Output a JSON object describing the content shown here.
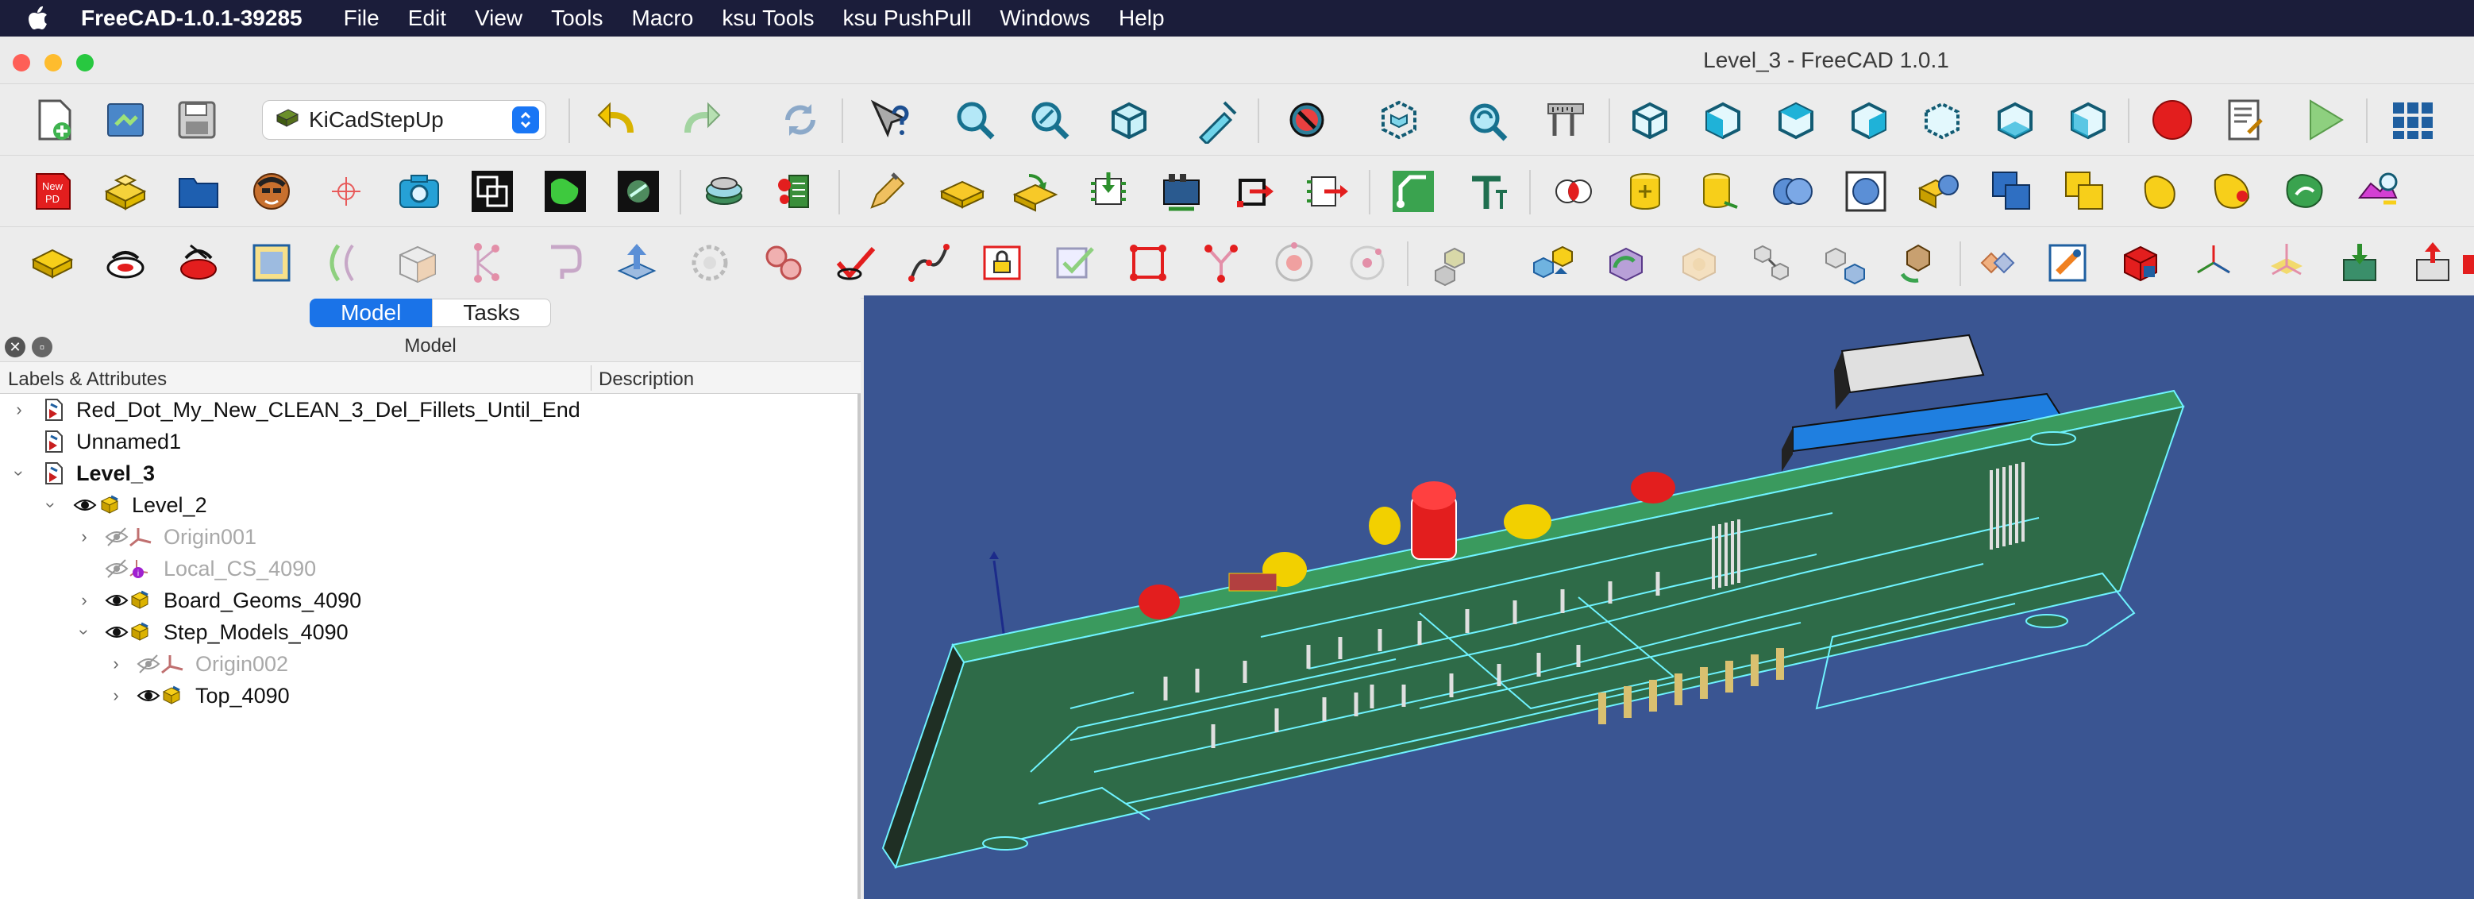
{
  "menubar": {
    "app_name": "FreeCAD-1.0.1-39285",
    "items": [
      "File",
      "Edit",
      "View",
      "Tools",
      "Macro",
      "ksu Tools",
      "ksu PushPull",
      "Windows",
      "Help"
    ]
  },
  "window": {
    "title": "Level_3 - FreeCAD 1.0.1"
  },
  "toolbar": {
    "workbench_selector": "KiCadStepUp",
    "new_pd_label_line1": "New",
    "new_pd_label_line2": "PD",
    "groups": [
      "file",
      "edit",
      "view",
      "macro",
      "workbenches",
      "kicad-stepup",
      "ksu-pushpull"
    ]
  },
  "left_panel": {
    "tabs": [
      "Model",
      "Tasks"
    ],
    "active_tab": "Model",
    "header": "Model",
    "columns": [
      "Labels & Attributes",
      "Description"
    ],
    "tree": [
      {
        "label": "Red_Dot_My_New_CLEAN_3_Del_Fillets_Until_End",
        "icon": "document-icon",
        "expanded": false
      },
      {
        "label": "Unnamed1",
        "icon": "document-icon",
        "expanded": false
      },
      {
        "label": "Level_3",
        "icon": "document-icon",
        "expanded": true,
        "active": true
      },
      {
        "label": "Level_2",
        "icon": "part-icon",
        "visible": true,
        "expanded": true
      },
      {
        "label": "Origin001",
        "icon": "origin-icon",
        "visible": false,
        "expanded": false
      },
      {
        "label": "Local_CS_4090",
        "icon": "coordinate-system-icon",
        "visible": false
      },
      {
        "label": "Board_Geoms_4090",
        "icon": "part-icon",
        "visible": true,
        "expanded": false
      },
      {
        "label": "Step_Models_4090",
        "icon": "part-icon",
        "visible": true,
        "expanded": true
      },
      {
        "label": "Origin002",
        "icon": "origin-icon",
        "visible": false,
        "expanded": false
      },
      {
        "label": "Top_4090",
        "icon": "part-icon",
        "visible": true,
        "expanded": false
      }
    ]
  },
  "viewport": {
    "background": "#3a5592",
    "board_color": "#2e7d52",
    "track_color": "#6ff3ff",
    "content": "3D PCB model rendered from below"
  },
  "colors": {
    "accent": "#1a73e8",
    "menubar_bg": "#1b1d3a"
  }
}
